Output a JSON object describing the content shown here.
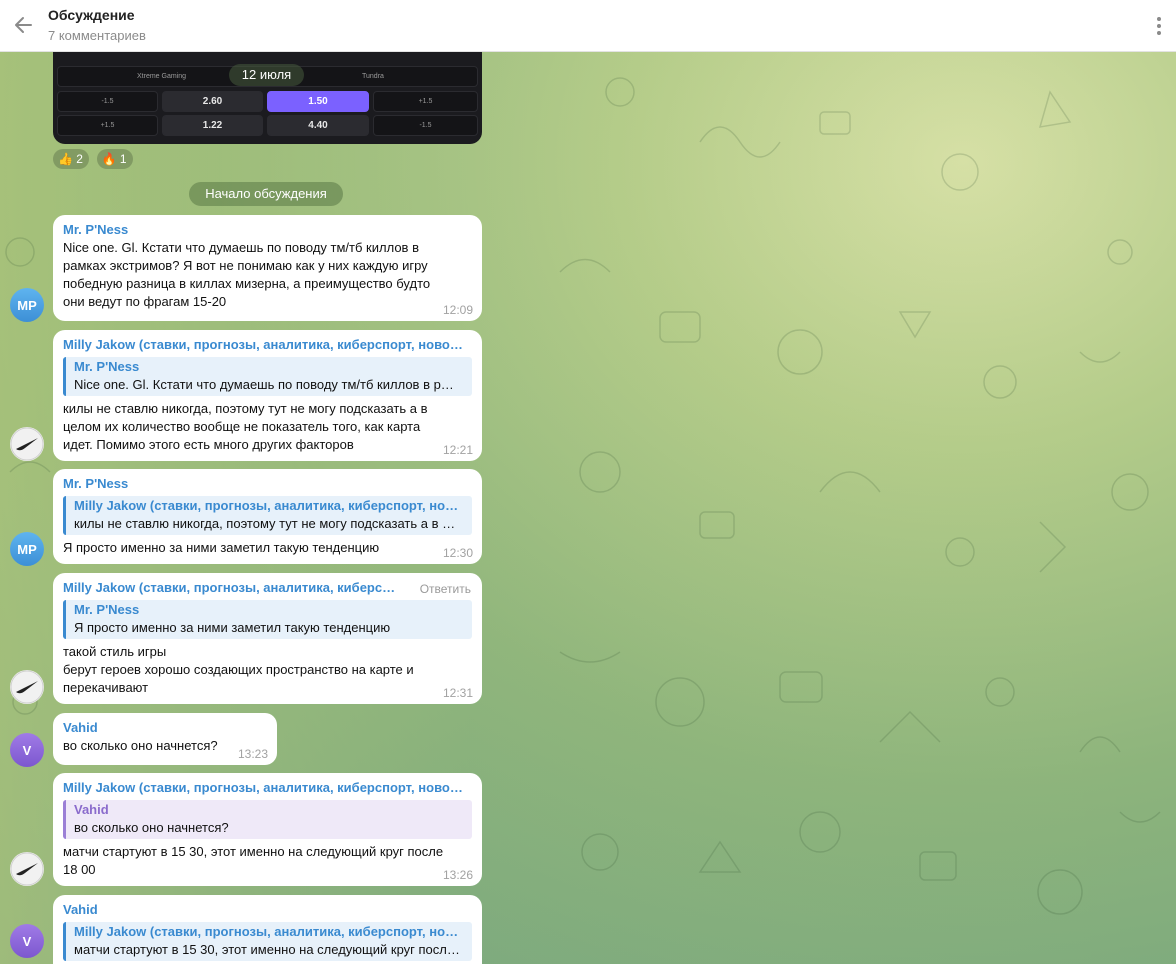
{
  "header": {
    "title": "Обсуждение",
    "subtitle": "7 комментариев"
  },
  "bet": {
    "team_left": "Xtreme Gaming",
    "team_right": "Tundra",
    "row1": [
      "-1.5",
      "2.60",
      "1.50",
      "+1.5"
    ],
    "row2": [
      "+1.5",
      "1.22",
      "4.40",
      "-1.5"
    ]
  },
  "date_label": "12 июля",
  "reactions": [
    {
      "emoji": "👍",
      "count": "2"
    },
    {
      "emoji": "🔥",
      "count": "1"
    }
  ],
  "system_label": "Начало обсуждения",
  "messages": [
    {
      "author": "Mr. P'Ness",
      "avatar": "MP",
      "text": "Nice one. Gl. Кстати что думаешь по поводу тм/тб киллов в рамках экстримов? Я вот не понимаю как у них каждую игру победную разница в киллах мизерна, а преимущество будто они ведут по фрагам 15-20",
      "time": "12:09"
    },
    {
      "author": "Milly Jakow (ставки, прогнозы, аналитика, киберспорт, ново…",
      "quote_author": "Mr. P'Ness",
      "quote_text": "Nice one. Gl. Кстати что думаешь по поводу тм/тб киллов в р…",
      "text": "килы не ставлю никогда, поэтому тут не могу подсказать а в целом их количество вообще не показатель того,  как карта идет. Помимо этого есть много других факторов",
      "time": "12:21"
    },
    {
      "author": "Mr. P'Ness",
      "avatar": "MP",
      "quote_author": "Milly Jakow (ставки, прогнозы, аналитика, киберспорт, но…",
      "quote_text": "килы не ставлю никогда, поэтому тут не могу подсказать а в …",
      "text": "Я просто именно за ними заметил такую тенденцию",
      "time": "12:30"
    },
    {
      "author": "Milly Jakow (ставки, прогнозы, аналитика, киберс…",
      "reply_label": "Ответить",
      "quote_author": "Mr. P'Ness",
      "quote_text": "Я просто именно за ними заметил такую тенденцию",
      "text_lines": [
        "такой стиль игры",
        "берут героев хорошо создающих пространство на карте и",
        "перекачивают"
      ],
      "time": "12:31"
    },
    {
      "author": "Vahid",
      "avatar": "V",
      "text": "во сколько оно начнется?",
      "time": "13:23"
    },
    {
      "author": "Milly Jakow (ставки, прогнозы, аналитика, киберспорт, ново…",
      "quote_author": "Vahid",
      "quote_text": "во сколько оно начнется?",
      "text": "матчи стартуют в 15 30, этот именно на следующий круг после 18 00",
      "time": "13:26"
    },
    {
      "author": "Vahid",
      "avatar": "V",
      "quote_author": "Milly Jakow (ставки, прогнозы, аналитика, киберспорт, но…",
      "quote_text": "матчи стартуют в 15 30, этот именно на следующий круг посл…"
    }
  ]
}
